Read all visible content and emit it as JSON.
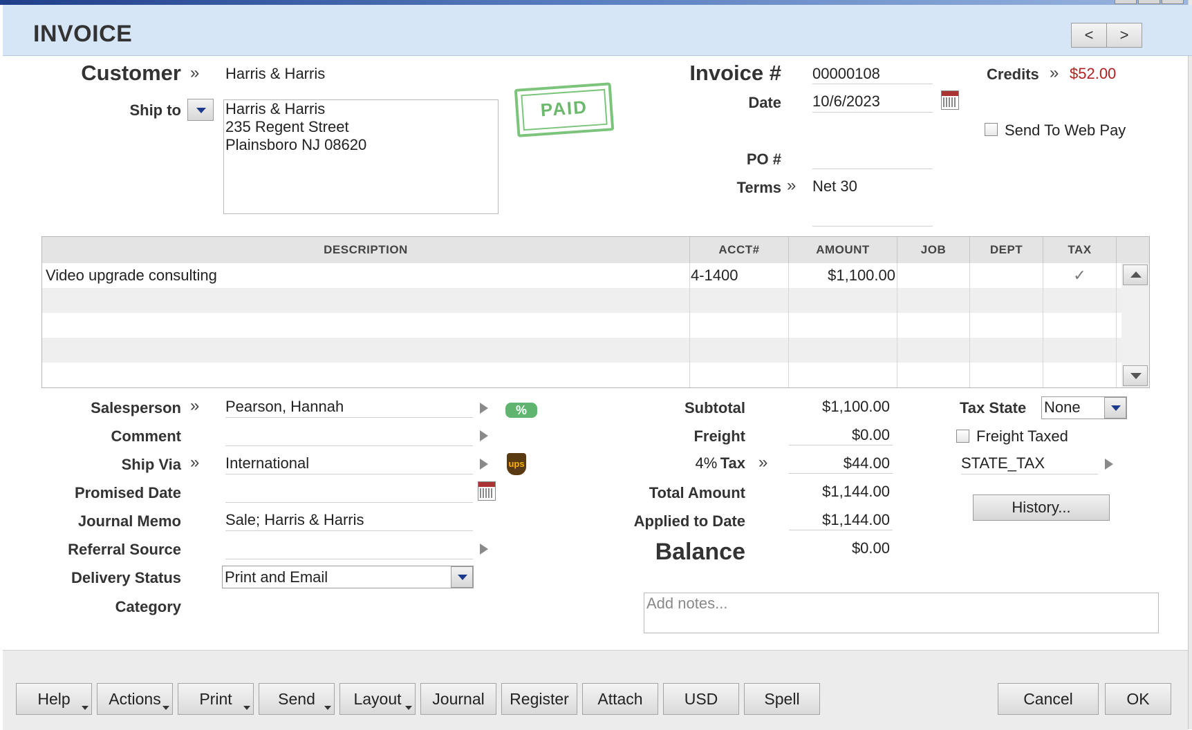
{
  "window": {
    "title": "INVOICE"
  },
  "nav": {
    "prev": "<",
    "next": ">"
  },
  "customer": {
    "label": "Customer",
    "value": "Harris & Harris"
  },
  "ship_to": {
    "label": "Ship to",
    "lines": [
      "Harris & Harris",
      "235 Regent Street",
      "Plainsboro NJ 08620"
    ]
  },
  "stamp": {
    "text": "PAID"
  },
  "invoice": {
    "number_label": "Invoice #",
    "number": "00000108",
    "date_label": "Date",
    "date": "10/6/2023",
    "po_label": "PO #",
    "po": "",
    "terms_label": "Terms",
    "terms": "Net 30"
  },
  "credits": {
    "label": "Credits",
    "value": "$52.00",
    "color": "#b02020"
  },
  "web_pay": {
    "label": "Send To Web Pay",
    "checked": false
  },
  "grid": {
    "columns": [
      "DESCRIPTION",
      "ACCT#",
      "AMOUNT",
      "JOB",
      "DEPT",
      "TAX"
    ],
    "rows": [
      {
        "description": "Video upgrade consulting",
        "acct": "4-1400",
        "amount": "$1,100.00",
        "job": "",
        "dept": "",
        "tax": "✓"
      }
    ]
  },
  "left_fields": {
    "salesperson": {
      "label": "Salesperson",
      "value": "Pearson, Hannah"
    },
    "comment": {
      "label": "Comment",
      "value": ""
    },
    "ship_via": {
      "label": "Ship Via",
      "value": "International"
    },
    "promised_date": {
      "label": "Promised Date",
      "value": ""
    },
    "journal_memo": {
      "label": "Journal Memo",
      "value": "Sale; Harris & Harris"
    },
    "referral_source": {
      "label": "Referral Source",
      "value": ""
    },
    "delivery_status": {
      "label": "Delivery Status",
      "value": "Print and Email"
    },
    "category": {
      "label": "Category",
      "value": ""
    }
  },
  "badges": {
    "percent": "%",
    "ups": "ups"
  },
  "totals": {
    "subtotal_label": "Subtotal",
    "subtotal": "$1,100.00",
    "freight_label": "Freight",
    "freight": "$0.00",
    "tax_rate": "4%",
    "tax_label": "Tax",
    "tax": "$44.00",
    "total_label": "Total Amount",
    "total": "$1,144.00",
    "applied_label": "Applied to Date",
    "applied": "$1,144.00",
    "balance_label": "Balance",
    "balance": "$0.00"
  },
  "tax_panel": {
    "tax_state_label": "Tax State",
    "tax_state": "None",
    "freight_taxed_label": "Freight Taxed",
    "freight_taxed": false,
    "tax_code": "STATE_TAX",
    "history_label": "History..."
  },
  "notes": {
    "placeholder": "Add notes..."
  },
  "footer": {
    "buttons": [
      "Help",
      "Actions",
      "Print",
      "Send",
      "Layout",
      "Journal",
      "Register",
      "Attach",
      "USD",
      "Spell"
    ],
    "cancel": "Cancel",
    "ok": "OK"
  }
}
